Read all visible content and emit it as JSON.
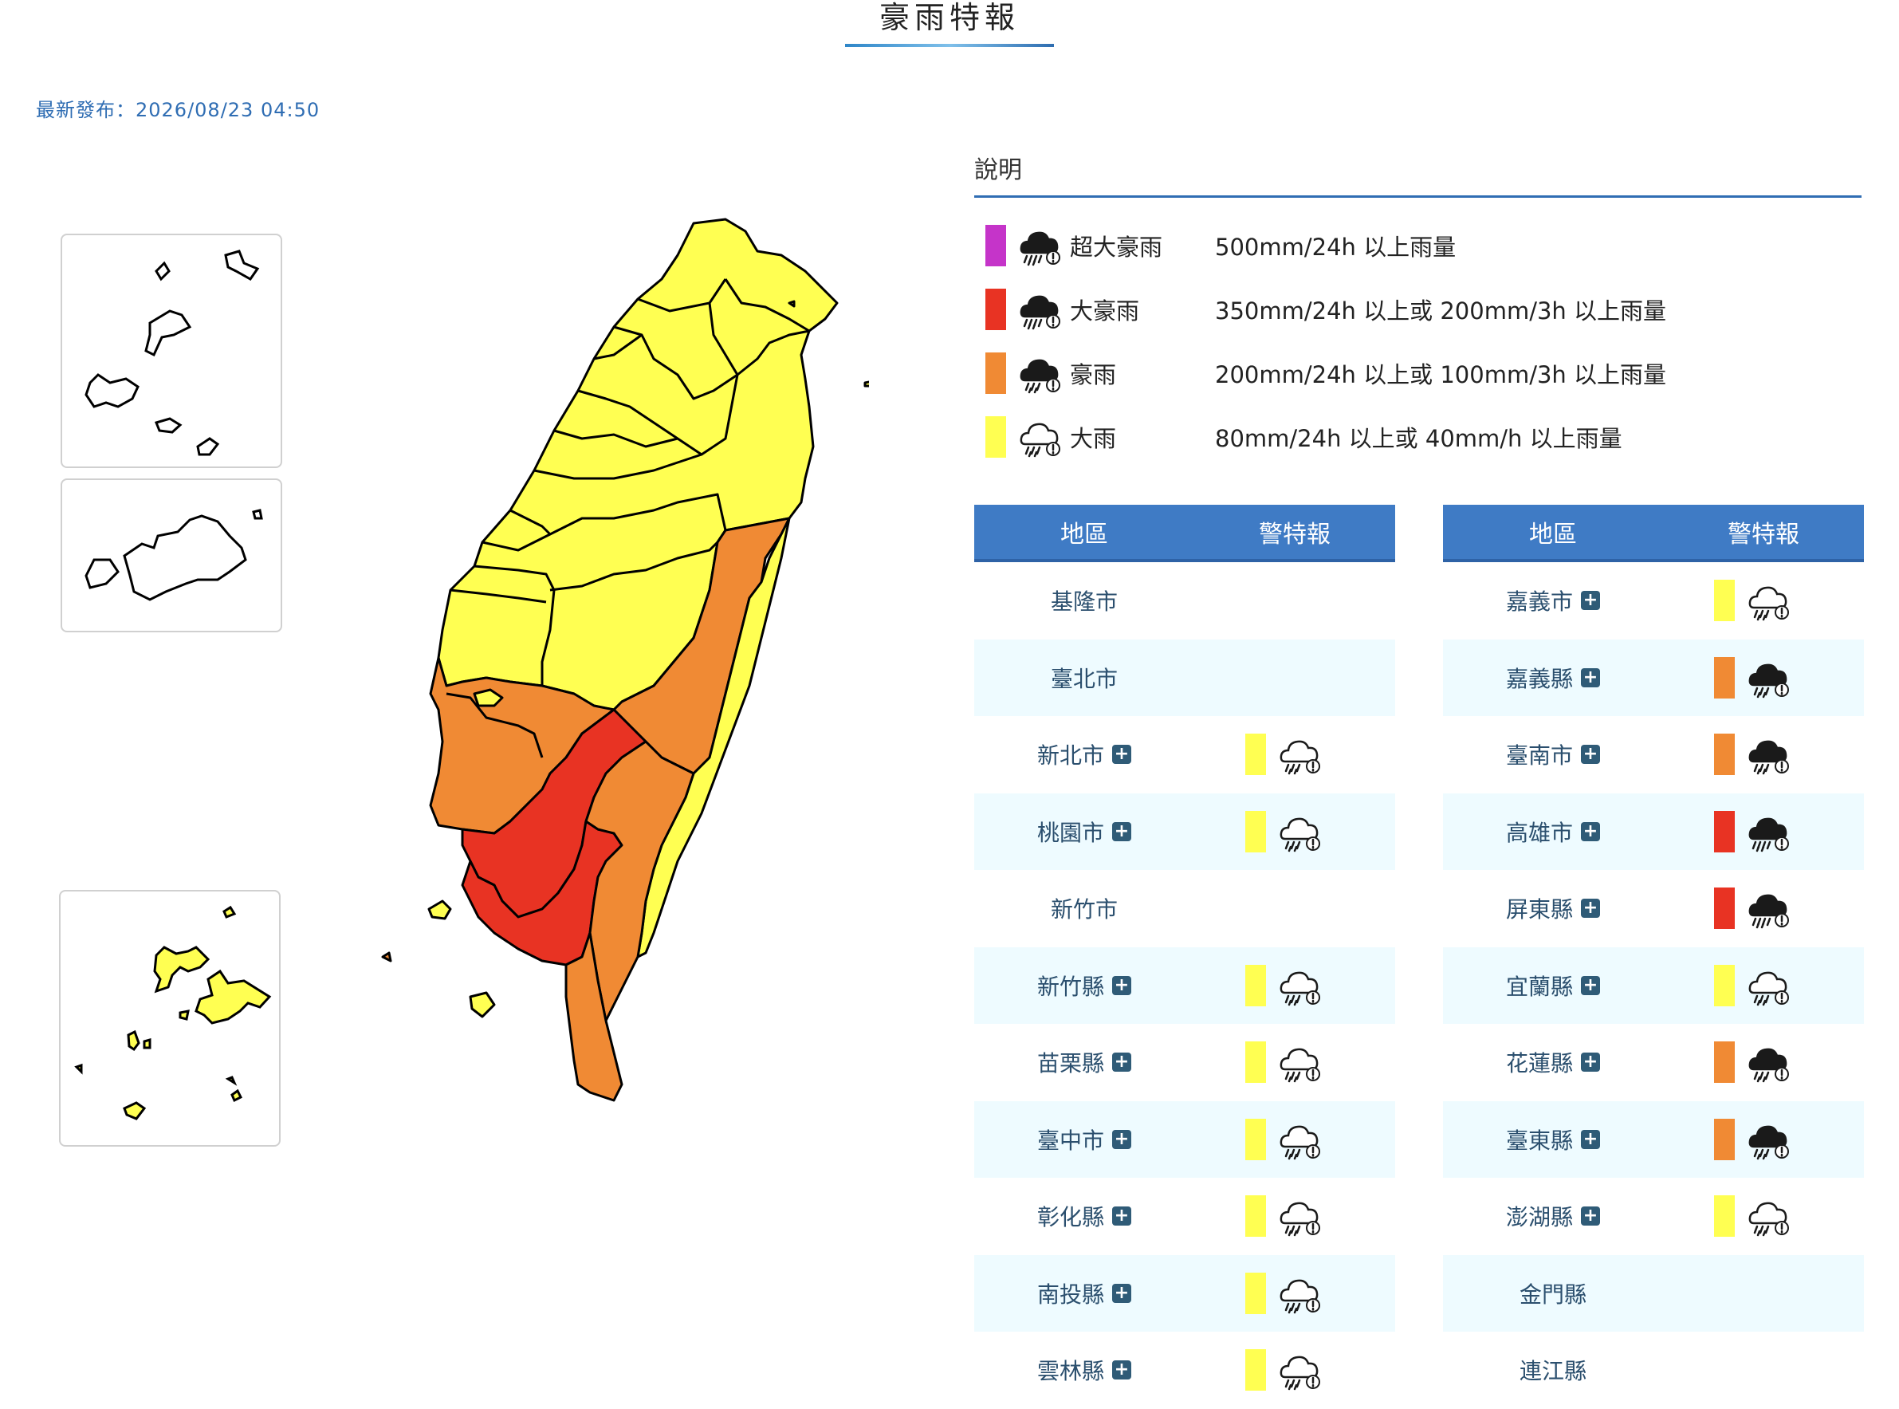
{
  "header": {
    "title": "豪雨特報",
    "updated": "最新發布：2026/08/23 04:50"
  },
  "colors": {
    "extreme_torrential": "#c534c9",
    "torrential": "#e83323",
    "extremely_heavy": "#f08a34",
    "heavy": "#ffff52",
    "accent": "#2f6db3",
    "table_header": "#3f7bc5"
  },
  "legend": {
    "title": "說明",
    "items": [
      {
        "level": "超大豪雨",
        "desc": "500mm/24h 以上雨量",
        "color": "#c534c9",
        "icon": "torrential-rain-cloud-icon"
      },
      {
        "level": "大豪雨",
        "desc": "350mm/24h 以上或 200mm/3h 以上雨量",
        "color": "#e83323",
        "icon": "torrential-rain-cloud-icon"
      },
      {
        "level": "豪雨",
        "desc": "200mm/24h 以上或 100mm/3h 以上雨量",
        "color": "#f08a34",
        "icon": "heavy-rain-cloud-icon"
      },
      {
        "level": "大雨",
        "desc": "80mm/24h 以上或 40mm/h 以上雨量",
        "color": "#ffff52",
        "icon": "rain-cloud-outline-icon"
      }
    ]
  },
  "table_headers": {
    "area": "地區",
    "warning": "警特報"
  },
  "tables": [
    [
      {
        "name": "基隆市",
        "expand": false,
        "level": null
      },
      {
        "name": "臺北市",
        "expand": false,
        "level": null
      },
      {
        "name": "新北市",
        "expand": true,
        "level": "大雨"
      },
      {
        "name": "桃園市",
        "expand": true,
        "level": "大雨"
      },
      {
        "name": "新竹市",
        "expand": false,
        "level": null
      },
      {
        "name": "新竹縣",
        "expand": true,
        "level": "大雨"
      },
      {
        "name": "苗栗縣",
        "expand": true,
        "level": "大雨"
      },
      {
        "name": "臺中市",
        "expand": true,
        "level": "大雨"
      },
      {
        "name": "彰化縣",
        "expand": true,
        "level": "大雨"
      },
      {
        "name": "南投縣",
        "expand": true,
        "level": "大雨"
      },
      {
        "name": "雲林縣",
        "expand": true,
        "level": "大雨"
      }
    ],
    [
      {
        "name": "嘉義市",
        "expand": true,
        "level": "大雨"
      },
      {
        "name": "嘉義縣",
        "expand": true,
        "level": "豪雨"
      },
      {
        "name": "臺南市",
        "expand": true,
        "level": "豪雨"
      },
      {
        "name": "高雄市",
        "expand": true,
        "level": "大豪雨"
      },
      {
        "name": "屏東縣",
        "expand": true,
        "level": "大豪雨"
      },
      {
        "name": "宜蘭縣",
        "expand": true,
        "level": "大雨"
      },
      {
        "name": "花蓮縣",
        "expand": true,
        "level": "豪雨"
      },
      {
        "name": "臺東縣",
        "expand": true,
        "level": "豪雨"
      },
      {
        "name": "澎湖縣",
        "expand": true,
        "level": "大雨"
      },
      {
        "name": "金門縣",
        "expand": false,
        "level": null
      },
      {
        "name": "連江縣",
        "expand": false,
        "level": null
      }
    ]
  ],
  "map_regions": [
    {
      "name": "基隆市",
      "level": "大雨"
    },
    {
      "name": "臺北市",
      "level": "大雨"
    },
    {
      "name": "新北市",
      "level": "大雨"
    },
    {
      "name": "桃園市",
      "level": "大雨"
    },
    {
      "name": "新竹市",
      "level": "none"
    },
    {
      "name": "新竹縣",
      "level": "大雨"
    },
    {
      "name": "苗栗縣",
      "level": "大雨"
    },
    {
      "name": "臺中市",
      "level": "大雨"
    },
    {
      "name": "彰化縣",
      "level": "大雨"
    },
    {
      "name": "南投縣",
      "level": "大雨"
    },
    {
      "name": "雲林縣",
      "level": "大雨"
    },
    {
      "name": "嘉義縣",
      "level": "豪雨"
    },
    {
      "name": "嘉義市",
      "level": "大雨"
    },
    {
      "name": "臺南市",
      "level": "豪雨"
    },
    {
      "name": "高雄市",
      "level": "大豪雨"
    },
    {
      "name": "屏東縣",
      "level": "大豪雨"
    },
    {
      "name": "宜蘭縣",
      "level": "大雨"
    },
    {
      "name": "花蓮縣",
      "level": "豪雨"
    },
    {
      "name": "臺東縣",
      "level": "豪雨"
    },
    {
      "name": "澎湖縣",
      "level": "大雨"
    },
    {
      "name": "金門縣",
      "level": "none"
    },
    {
      "name": "連江縣",
      "level": "none"
    }
  ]
}
